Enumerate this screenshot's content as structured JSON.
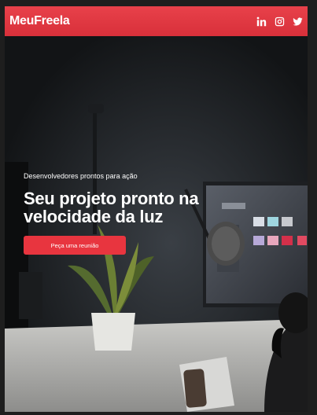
{
  "header": {
    "brand": "MeuFreela",
    "socials": [
      "linkedin-icon",
      "instagram-icon",
      "twitter-icon"
    ]
  },
  "hero": {
    "eyebrow": "Desenvolvedores prontos para ação",
    "headline": "Seu projeto pronto na velocidade da luz",
    "cta_label": "Peça uma reunião"
  },
  "colors": {
    "accent": "#e8353f",
    "header": "#e03a43",
    "background": "#0f1113"
  }
}
